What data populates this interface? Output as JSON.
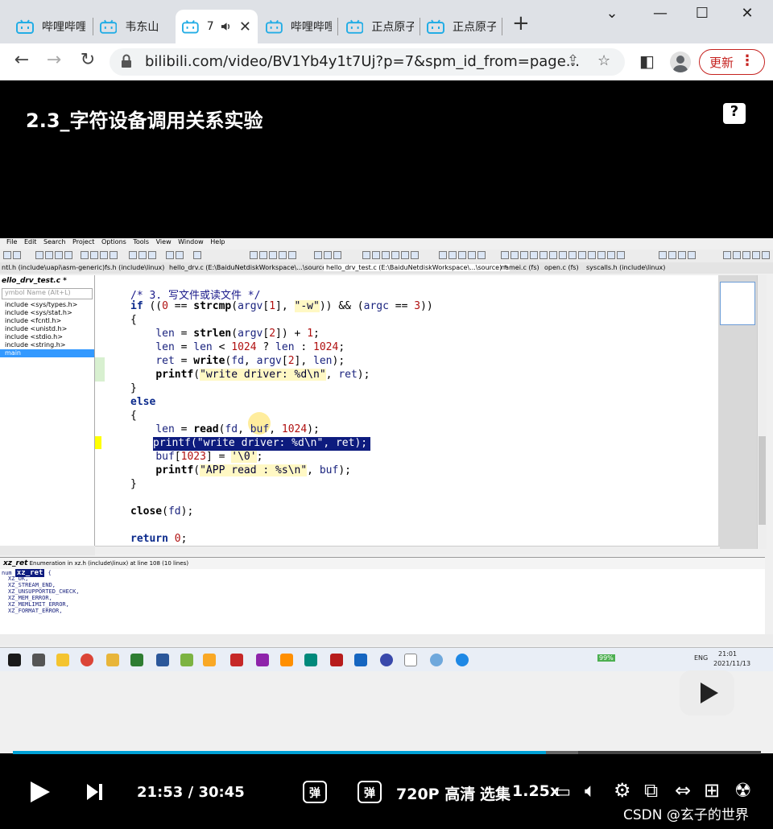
{
  "browser": {
    "tabs": [
      {
        "label": "哔哩哔哩"
      },
      {
        "label": "韦东山 "
      },
      {
        "label": "7"
      },
      {
        "label": "哔哩哔哩"
      },
      {
        "label": "正点原子"
      },
      {
        "label": "正点原子"
      }
    ],
    "url": "bilibili.com/video/BV1Yb4y1t7Uj?p=7&spm_id_from=page...",
    "update_label": "更新"
  },
  "video": {
    "title": "2.3_字符设备调用关系实验",
    "help_label": "?",
    "progress_fraction": 0.7124
  },
  "ide": {
    "menu": [
      "File",
      "Edit",
      "Search",
      "Project",
      "Options",
      "Tools",
      "View",
      "Window",
      "Help"
    ],
    "file_tabs": [
      "ntl.h (include\\uapi\\asm-generic)",
      "fs.h (include\\linux)",
      "hello_drv.c (E:\\BaiduNetdiskWorkspace\\...\\source)",
      "hello_drv_test.c (E:\\BaiduNetdiskWorkspace\\...\\source) *",
      "namei.c (fs)",
      "open.c (fs)",
      "syscalls.h (include\\linux)"
    ],
    "symbol_title": "ello_drv_test.c *",
    "symbol_search_placeholder": "ymbol Name (Alt+L)",
    "symbols": [
      "include <sys/types.h>",
      "include <sys/stat.h>",
      "include <fcntl.h>",
      "include <unistd.h>",
      "include <stdio.h>",
      "include <string.h>",
      "main"
    ],
    "context_header": "Enumeration in xz.h (include\\linux) at line 108 (10 lines)",
    "context_symbol": "xz_ret",
    "context_lines": [
      "XZ_OK,",
      "XZ_STREAM_END,",
      "XZ_UNSUPPORTED_CHECK,",
      "XZ_MEM_ERROR,",
      "XZ_MEMLIMIT_ERROR,",
      "XZ_FORMAT_ERROR,"
    ],
    "tray": {
      "lang": "ENG",
      "time": "21:01",
      "date": "2021/11/13",
      "battery": "99%"
    }
  },
  "player": {
    "current_time": "21:53",
    "separator": "/",
    "total_time": "30:45",
    "danmaku_label": "弹",
    "quality_label": "720P 高清",
    "episodes_label": "选集",
    "speed_label": "1.25x",
    "watermark": "CSDN @玄子的世界"
  }
}
